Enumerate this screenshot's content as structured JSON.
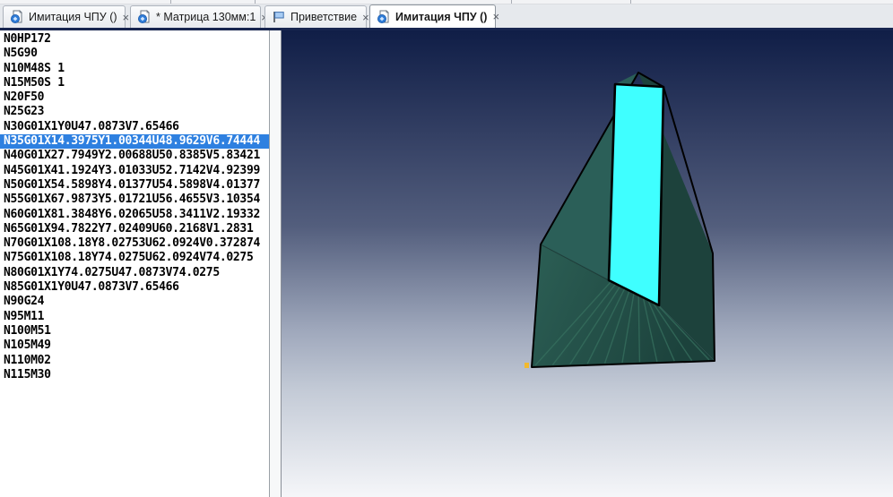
{
  "ui": {
    "close_glyph": "×"
  },
  "tabs": [
    {
      "label": "Имитация ЧПУ ()",
      "icon": "cnc-document-icon",
      "active": false
    },
    {
      "label": "* Матрица 130мм:1",
      "icon": "cnc-document-icon",
      "active": false
    },
    {
      "label": "Приветствие",
      "icon": "flag-icon",
      "active": false
    },
    {
      "label": "Имитация ЧПУ ()",
      "icon": "cnc-document-icon",
      "active": true
    }
  ],
  "gcode": {
    "selected_index": 7,
    "selection_color": "#2E80E0",
    "lines": [
      "N0HP172",
      "N5G90",
      "N10M48S 1",
      "N15M50S 1",
      "N20F50",
      "N25G23",
      "N30G01X1Y0U47.0873V7.65466",
      "N35G01X14.3975Y1.00344U48.9629V6.74444",
      "N40G01X27.7949Y2.00688U50.8385V5.83421",
      "N45G01X41.1924Y3.01033U52.7142V4.92399",
      "N50G01X54.5898Y4.01377U54.5898V4.01377",
      "N55G01X67.9873Y5.01721U56.4655V3.10354",
      "N60G01X81.3848Y6.02065U58.3411V2.19332",
      "N65G01X94.7822Y7.02409U60.2168V1.2831",
      "N70G01X108.18Y8.02753U62.0924V0.372874",
      "N75G01X108.18Y74.0275U62.0924V74.0275",
      "N80G01X1Y74.0275U47.0873V74.0275",
      "N85G01X1Y0U47.0873V7.65466",
      "N90G24",
      "N95M11",
      "N100M51",
      "N105M49",
      "N110M02",
      "N115M30"
    ]
  },
  "viewport": {
    "bg": {
      "s0": "#101E47",
      "s1": "#333F63",
      "s2": "#535E7D",
      "s3": "#9EA7BB",
      "s4": "#C3CAD6",
      "s5": "#F5F6F9"
    },
    "colors": {
      "left_face": "#2B5F58",
      "right_face": "#1D423C",
      "fan_light": "#2C5F55",
      "fan_dark": "#1C423C",
      "slot_face": "#3FFFFF",
      "outline": "#000000",
      "fan_line": "#37705F",
      "marker": "#F2B92E"
    }
  }
}
